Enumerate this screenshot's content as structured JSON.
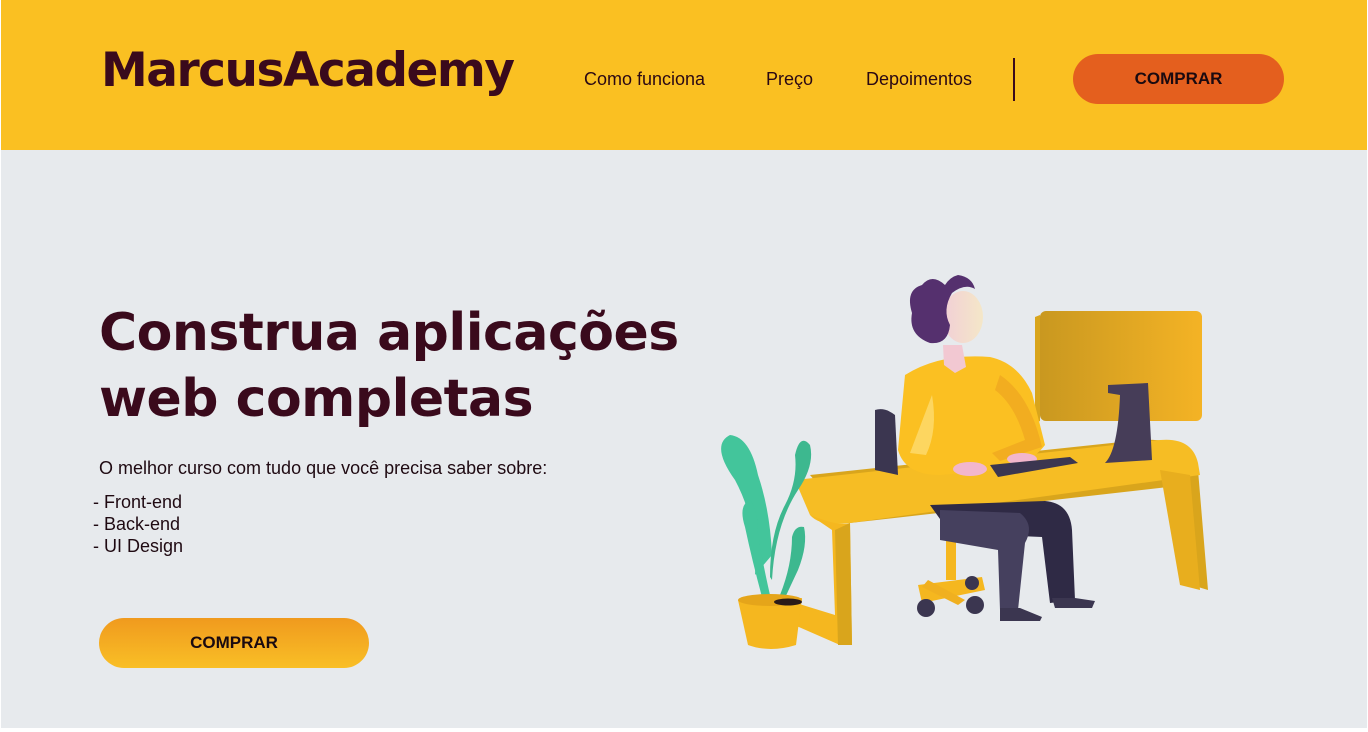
{
  "header": {
    "logo": "MarcusAcademy",
    "nav": [
      "Como funciona",
      "Preço",
      "Depoimentos"
    ],
    "cta_label": "COMPRAR"
  },
  "hero": {
    "title_line1": "Construa aplicações",
    "title_line2": "web completas",
    "subtitle": "O melhor curso com tudo que você precisa saber sobre:",
    "topics": [
      "- Front-end",
      "- Back-end",
      "- UI Design"
    ],
    "cta_label": "COMPRAR"
  },
  "colors": {
    "header_bg": "#fac022",
    "hero_bg": "#e7eaed",
    "brand_text": "#3a0a1c",
    "header_button": "#e45f1e",
    "hero_button": "#f9bf26"
  },
  "icons": [
    "person-at-desk-illustration",
    "plant-illustration"
  ]
}
